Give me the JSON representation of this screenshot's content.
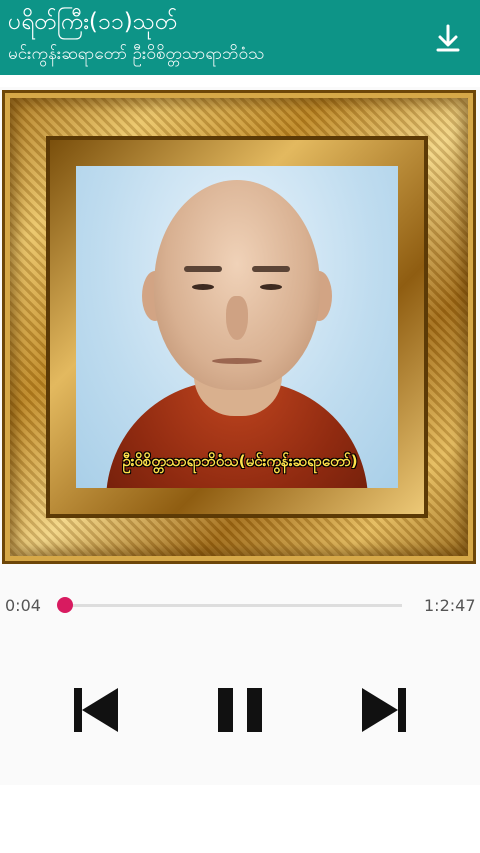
{
  "appbar": {
    "title": "ပရိတ်ကြီး(၁၁)သုတ်",
    "subtitle": "မင်းကွန်းဆရာတော် ဦးဝိစိတ္တသာရာဘိဝံသ",
    "download_icon": "download-icon"
  },
  "artwork": {
    "caption": "ဦးဝိစိတ္တသာရာဘိဝံသ(မင်းကွန်းဆရာတော်)"
  },
  "player": {
    "current_time": "0:04",
    "total_time": "1:2:47",
    "progress": 0.01,
    "accent_color": "#d81b60",
    "controls": {
      "prev_icon": "skip-previous-icon",
      "pause_icon": "pause-icon",
      "next_icon": "skip-next-icon"
    }
  },
  "theme": {
    "appbar_color": "#0d9487"
  }
}
